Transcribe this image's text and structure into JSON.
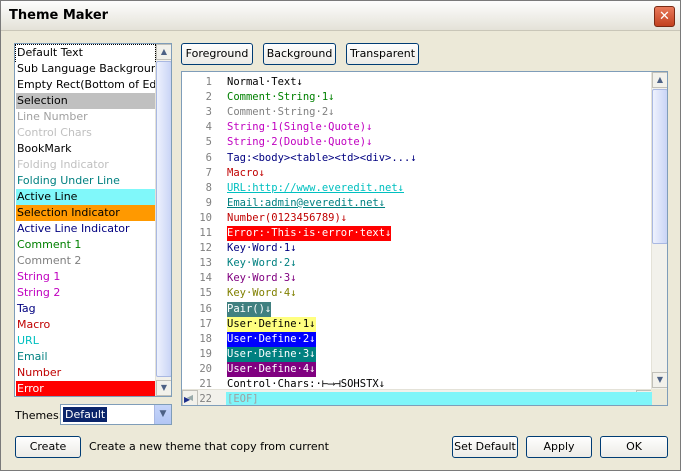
{
  "window": {
    "title": "Theme Maker",
    "close_glyph": "✕"
  },
  "list": {
    "items": [
      {
        "label": "Default Text",
        "fg": "#000000",
        "bg": "#ffffff",
        "focused": true
      },
      {
        "label": "Sub Language Background",
        "fg": "#000000",
        "bg": "#ffffff"
      },
      {
        "label": "Empty Rect(Bottom of Edit)",
        "fg": "#000000",
        "bg": "#ffffff"
      },
      {
        "label": "Selection",
        "fg": "#000000",
        "bg": "#c0c0c0"
      },
      {
        "label": "Line Number",
        "fg": "#a0a0a0",
        "bg": "#ffffff"
      },
      {
        "label": "Control Chars",
        "fg": "#c0c0c0",
        "bg": "#ffffff"
      },
      {
        "label": "BookMark",
        "fg": "#000000",
        "bg": "#ffffff"
      },
      {
        "label": "Folding Indicator",
        "fg": "#c0c0c0",
        "bg": "#ffffff"
      },
      {
        "label": "Folding Under Line",
        "fg": "#008080",
        "bg": "#ffffff"
      },
      {
        "label": "Active Line",
        "fg": "#000000",
        "bg": "#80f8fa"
      },
      {
        "label": "Selection Indicator",
        "fg": "#000000",
        "bg": "#ff9900"
      },
      {
        "label": "Active Line Indicator",
        "fg": "#000080",
        "bg": "#ffffff"
      },
      {
        "label": "Comment 1",
        "fg": "#008000",
        "bg": "#ffffff"
      },
      {
        "label": "Comment 2",
        "fg": "#808080",
        "bg": "#ffffff"
      },
      {
        "label": "String 1",
        "fg": "#c000c0",
        "bg": "#ffffff"
      },
      {
        "label": "String 2",
        "fg": "#c000c0",
        "bg": "#ffffff"
      },
      {
        "label": "Tag",
        "fg": "#000080",
        "bg": "#ffffff"
      },
      {
        "label": "Macro",
        "fg": "#c00000",
        "bg": "#ffffff"
      },
      {
        "label": "URL",
        "fg": "#00c0c0",
        "bg": "#ffffff"
      },
      {
        "label": "Email",
        "fg": "#008080",
        "bg": "#ffffff"
      },
      {
        "label": "Number",
        "fg": "#c00000",
        "bg": "#ffffff"
      },
      {
        "label": "Error",
        "fg": "#ffffff",
        "bg": "#ff0000"
      }
    ]
  },
  "themes": {
    "label": "Themes:",
    "value": "Default"
  },
  "toolbar": {
    "foreground": "Foreground",
    "background": "Background",
    "transparent": "Transparent"
  },
  "editor": {
    "lines": [
      {
        "n": "1",
        "text": "Normal·Text↓",
        "fg": "#000000",
        "bg": ""
      },
      {
        "n": "2",
        "text": "Comment·String·1↓",
        "fg": "#008000",
        "bg": ""
      },
      {
        "n": "3",
        "text": "Comment·String·2↓",
        "fg": "#808080",
        "bg": ""
      },
      {
        "n": "4",
        "text": "String·1(Single·Quote)↓",
        "fg": "#c000c0",
        "bg": ""
      },
      {
        "n": "5",
        "text": "String·2(Double·Quote)↓",
        "fg": "#c000c0",
        "bg": ""
      },
      {
        "n": "6",
        "text": "Tag:<body><table><td><div>...↓",
        "fg": "#000080",
        "bg": ""
      },
      {
        "n": "7",
        "text": "Macro↓",
        "fg": "#c00000",
        "bg": ""
      },
      {
        "n": "8",
        "text": "URL:http://www.everedit.net↓",
        "fg": "#00c0c0",
        "bg": "",
        "underline": true
      },
      {
        "n": "9",
        "text": "Email:admin@everedit.net↓",
        "fg": "#008080",
        "bg": "",
        "underline": true
      },
      {
        "n": "10",
        "text": "Number(0123456789)↓",
        "fg": "#c00000",
        "bg": ""
      },
      {
        "n": "11",
        "text": "Error:·This·is·error·text↓",
        "fg": "#ffffff",
        "bg": "#ff0000"
      },
      {
        "n": "12",
        "text": "Key·Word·1↓",
        "fg": "#000080",
        "bg": ""
      },
      {
        "n": "13",
        "text": "Key·Word·2↓",
        "fg": "#008080",
        "bg": ""
      },
      {
        "n": "14",
        "text": "Key·Word·3↓",
        "fg": "#800080",
        "bg": ""
      },
      {
        "n": "15",
        "text": "Key·Word·4↓",
        "fg": "#808000",
        "bg": ""
      },
      {
        "n": "16",
        "text": "Pair()↓",
        "fg": "#ffffff",
        "bg": "#408080"
      },
      {
        "n": "17",
        "text": "User·Define·1↓",
        "fg": "#000000",
        "bg": "#ffff80"
      },
      {
        "n": "18",
        "text": "User·Define·2↓",
        "fg": "#ffffff",
        "bg": "#0000ff"
      },
      {
        "n": "19",
        "text": "User·Define·3↓",
        "fg": "#ffffff",
        "bg": "#008080"
      },
      {
        "n": "20",
        "text": "User·Define·4↓",
        "fg": "#ffffff",
        "bg": "#800080"
      },
      {
        "n": "21",
        "text": "Control·Chars:·⊢⟶⊣SOHSTX↓",
        "fg": "#000000",
        "bg": ""
      },
      {
        "n": "22",
        "text": "[EOF]",
        "fg": "#a0a0a0",
        "bg": "",
        "active": true
      }
    ]
  },
  "footer": {
    "create": "Create",
    "hint": "Create a new theme that copy from current",
    "set_default": "Set Default",
    "apply": "Apply",
    "ok": "OK"
  }
}
